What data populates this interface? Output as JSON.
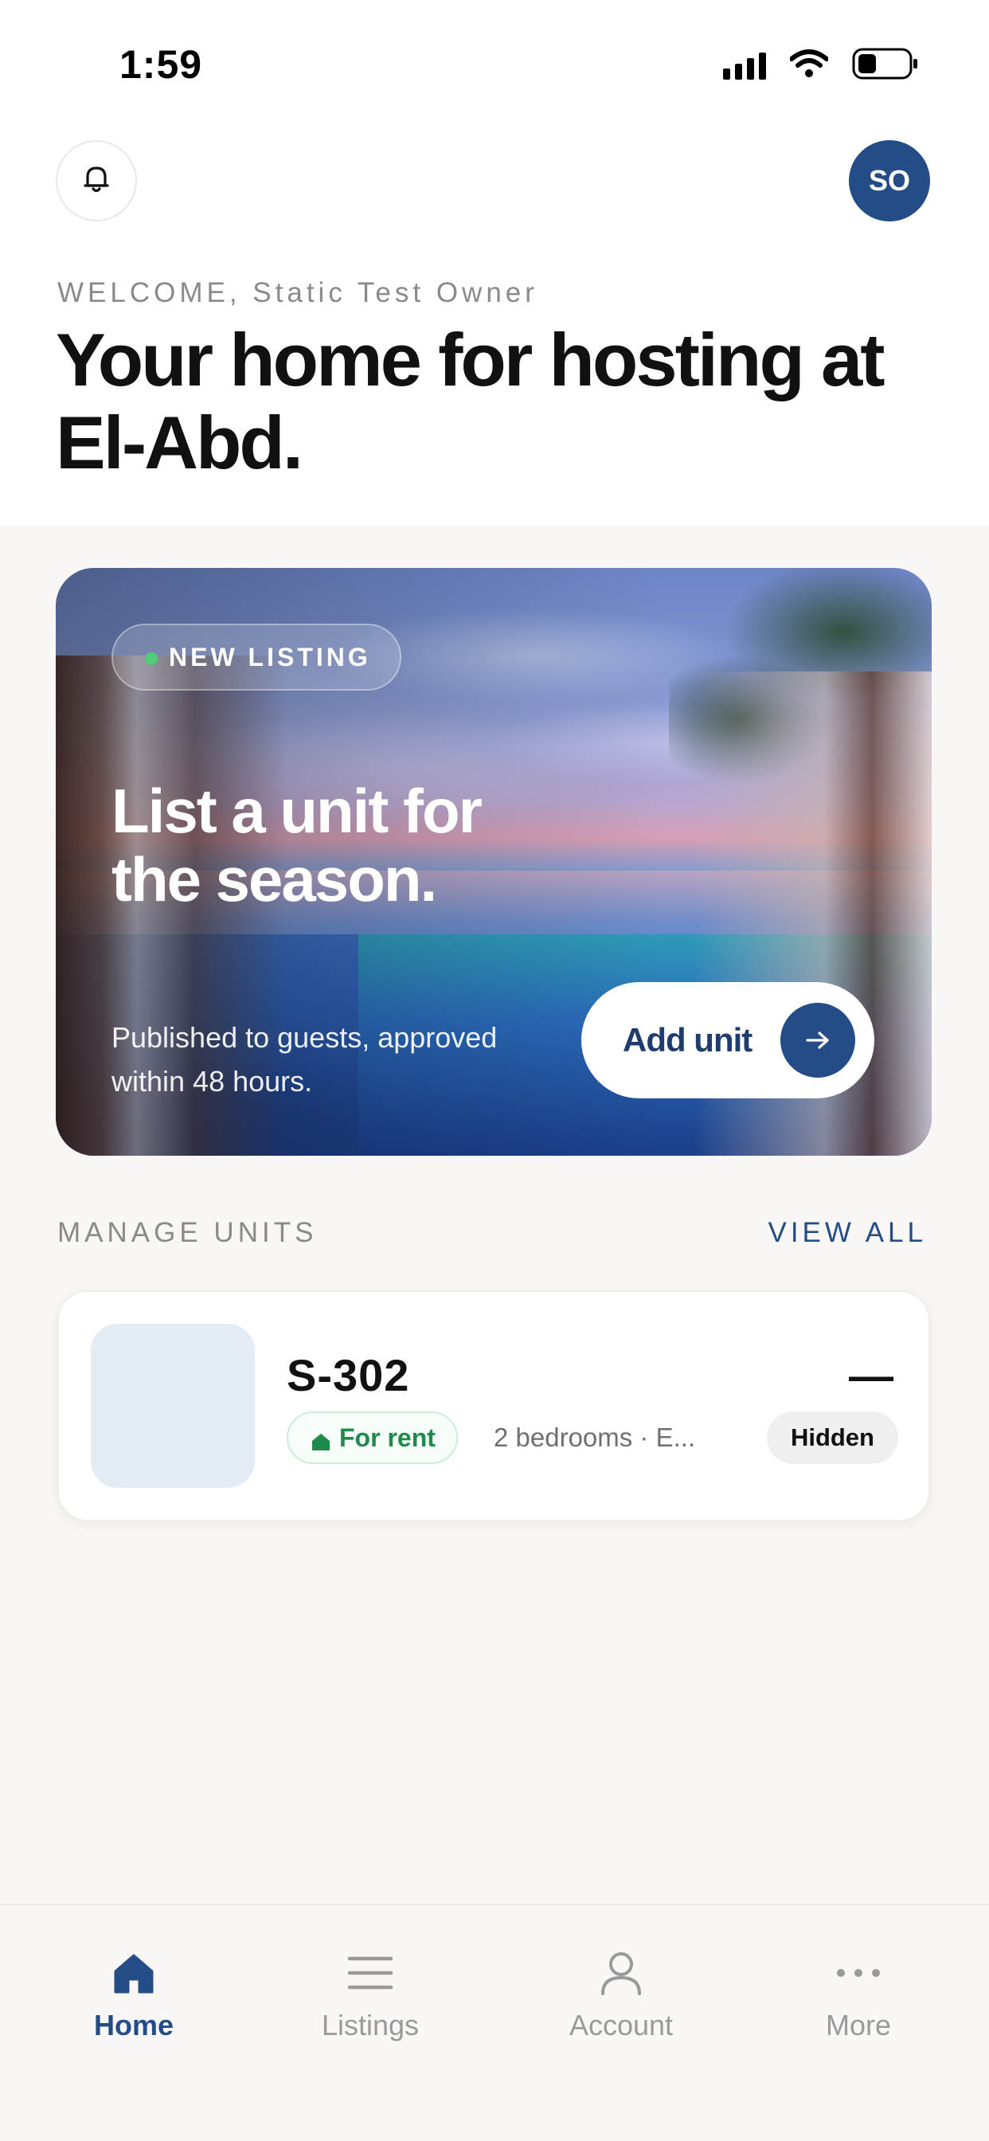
{
  "status_bar": {
    "time": "1:59"
  },
  "header": {
    "avatar_initials": "SO",
    "welcome": "WELCOME, Static Test Owner",
    "headline": "Your home for hosting at El-Abd."
  },
  "hero": {
    "chip": "NEW LISTING",
    "title": "List a unit for the season.",
    "subtitle": "Published to guests, approved within 48 hours.",
    "cta_label": "Add unit"
  },
  "manage_units": {
    "section_label": "MANAGE UNITS",
    "view_all_label": "VIEW ALL",
    "units": [
      {
        "code": "S-302",
        "status_value": "—",
        "type_label": "For rent",
        "meta": "2 bedrooms · E...",
        "visibility": "Hidden"
      }
    ]
  },
  "tab_bar": {
    "tabs": [
      {
        "label": "Home",
        "icon": "home-icon",
        "active": true
      },
      {
        "label": "Listings",
        "icon": "list-icon",
        "active": false
      },
      {
        "label": "Account",
        "icon": "person-icon",
        "active": false
      },
      {
        "label": "More",
        "icon": "more-icon",
        "active": false
      }
    ]
  },
  "colors": {
    "accent": "#244c87",
    "rent_green": "#1e8a4c",
    "muted_text": "#8a8a8a",
    "background": "#f8f7f5"
  }
}
